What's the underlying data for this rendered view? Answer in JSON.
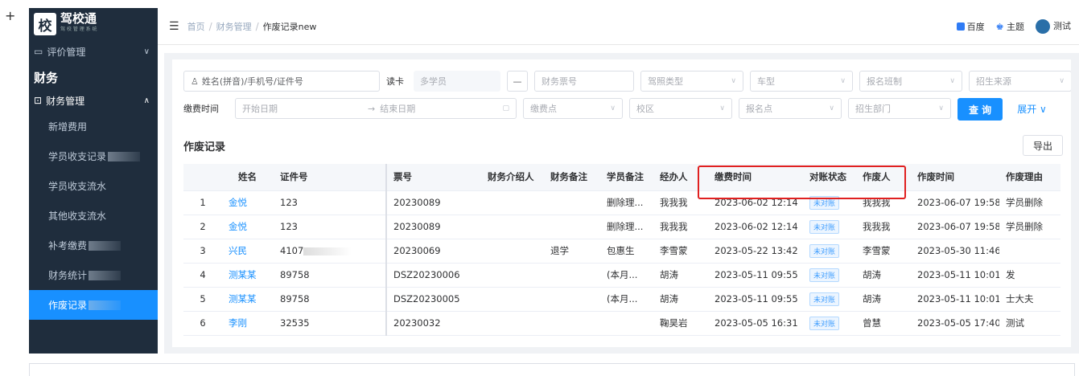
{
  "logo": {
    "mark": "校",
    "name": "驾校通",
    "tagline": "驾 校 管 理 系 统"
  },
  "sidebar": {
    "eval_menu": "评价管理",
    "section": "财务",
    "finance_menu": "财务管理",
    "items": [
      "新增费用",
      "学员收支记录",
      "学员收支流水",
      "其他收支流水",
      "补考缴费",
      "财务统计",
      "作废记录"
    ]
  },
  "breadcrumb": [
    "首页",
    "财务管理",
    "作废记录new"
  ],
  "topbar": {
    "baidu": "百度",
    "theme": "主题",
    "user": "测试"
  },
  "filters": {
    "name_ph": "姓名(拼音)/手机号/证件号",
    "read_card": "读卡",
    "multi_student": "多学员",
    "finance_no_ph": "财务票号",
    "license_type_ph": "驾照类型",
    "car_type_ph": "车型",
    "class_ph": "报名班制",
    "source_ph": "招生来源",
    "pay_time_label": "缴费时间",
    "start_date_ph": "开始日期",
    "end_date_ph": "结束日期",
    "pay_point_ph": "缴费点",
    "campus_ph": "校区",
    "reg_point_ph": "报名点",
    "dept_ph": "招生部门",
    "query": "查 询",
    "expand": "展开 ∨"
  },
  "records": {
    "title": "作废记录",
    "export": "导出",
    "columns": [
      "",
      "姓名",
      "证件号",
      "票号",
      "财务介绍人",
      "财务备注",
      "学员备注",
      "经办人",
      "缴费时间",
      "对账状态",
      "作废人",
      "作废时间",
      "作废理由"
    ],
    "rows": [
      {
        "idx": "1",
        "name": "金悦",
        "id": "123",
        "ticket": "20230089",
        "introducer": "",
        "fin_note": "",
        "stu_note": "删除理...",
        "handler": "我我我",
        "pay_time": "2023-06-02 12:14",
        "status": "未对账",
        "voider": "我我我",
        "void_time": "2023-06-07 19:58",
        "reason": "学员删除"
      },
      {
        "idx": "2",
        "name": "金悦",
        "id": "123",
        "ticket": "20230089",
        "introducer": "",
        "fin_note": "",
        "stu_note": "删除理...",
        "handler": "我我我",
        "pay_time": "2023-06-02 12:14",
        "status": "未对账",
        "voider": "我我我",
        "void_time": "2023-06-07 19:58",
        "reason": "学员删除"
      },
      {
        "idx": "3",
        "name": "兴民",
        "id": "4107",
        "ticket": "20230069",
        "introducer": "",
        "fin_note": "退学",
        "stu_note": "包惠生",
        "handler": "李雪蒙",
        "pay_time": "2023-05-22 13:42",
        "status": "未对账",
        "voider": "李雪蒙",
        "void_time": "2023-05-30 11:46",
        "reason": ""
      },
      {
        "idx": "4",
        "name": "测某某",
        "id": "89758",
        "ticket": "DSZ20230006",
        "introducer": "",
        "fin_note": "",
        "stu_note": "(本月...",
        "handler": "胡涛",
        "pay_time": "2023-05-11 09:55",
        "status": "未对账",
        "voider": "胡涛",
        "void_time": "2023-05-11 10:01",
        "reason": "发"
      },
      {
        "idx": "5",
        "name": "测某某",
        "id": "89758",
        "ticket": "DSZ20230005",
        "introducer": "",
        "fin_note": "",
        "stu_note": "(本月...",
        "handler": "胡涛",
        "pay_time": "2023-05-11 09:55",
        "status": "未对账",
        "voider": "胡涛",
        "void_time": "2023-05-11 10:01",
        "reason": "士大夫"
      },
      {
        "idx": "6",
        "name": "李刚",
        "id": "32535",
        "ticket": "20230032",
        "introducer": "",
        "fin_note": "",
        "stu_note": "",
        "handler": "鞠昊岩",
        "pay_time": "2023-05-05 16:31",
        "status": "未对账",
        "voider": "曾慧",
        "void_time": "2023-05-05 17:40",
        "reason": "测试"
      }
    ]
  }
}
